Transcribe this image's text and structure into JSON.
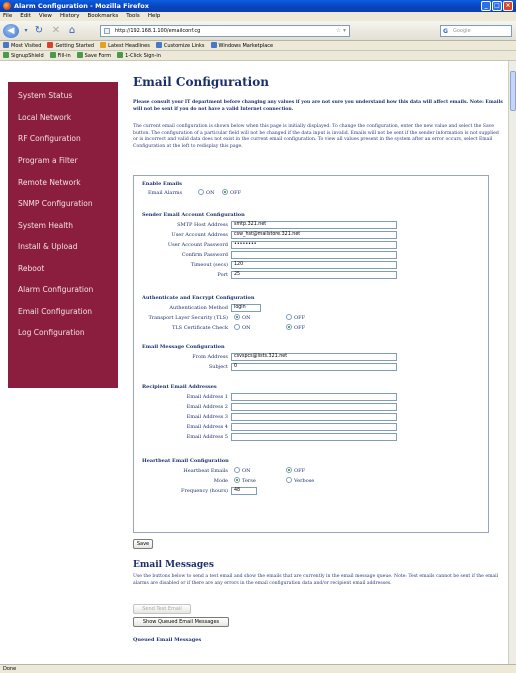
{
  "window": {
    "title": "Alarm Configuration - Mozilla Firefox"
  },
  "menu": [
    "File",
    "Edit",
    "View",
    "History",
    "Bookmarks",
    "Tools",
    "Help"
  ],
  "nav": {
    "url": "http://192.168.1.100/emailconf.cg",
    "search_placeholder": "Google"
  },
  "bookmarks": [
    {
      "label": "Most Visited",
      "color": "#4a78c8"
    },
    {
      "label": "Getting Started",
      "color": "#d8442a"
    },
    {
      "label": "Latest Headlines",
      "color": "#e8a020"
    },
    {
      "label": "Customize Links",
      "color": "#4a78c8"
    },
    {
      "label": "Windows Marketplace",
      "color": "#4a78c8"
    }
  ],
  "bookmarks2": [
    {
      "label": "SignupShield",
      "color": "#4a9a4a"
    },
    {
      "label": "Fill-in",
      "color": "#4a9a4a"
    },
    {
      "label": "Save Form",
      "color": "#4a9a4a"
    },
    {
      "label": "1-Click Sign-in",
      "color": "#4a9a4a"
    }
  ],
  "sidebar": {
    "items": [
      "System Status",
      "Local Network",
      "RF Configuration",
      "Program a Filter",
      "Remote Network",
      "SNMP Configuration",
      "System Health",
      "Install & Upload",
      "Reboot",
      "Alarm Configuration",
      "Email Configuration",
      "Log Configuration"
    ]
  },
  "page": {
    "title": "Email Configuration",
    "warning": "Please consult your IT department before changing any values if you are not sure you understand how this data will affect emails.  Note: Emails will not be sent if you do not have a valid Internet connection.",
    "intro": "The current email configuration is shown below when this page is initially displayed. To change the configuration, enter the new value and select the Save button. The configuration of a particular field will not be changed if the data input is invalid. Emails will not be sent if the sender information is not supplied or is incorrect and valid data does not exist in the current email configuration. To view all values present in the system after an error occurs, select Email Configuration at the left to redisplay this page."
  },
  "form": {
    "enable": {
      "heading": "Enable Emails",
      "label": "Email Alarms",
      "on": "ON",
      "off": "OFF",
      "selected": "off"
    },
    "sender": {
      "heading": "Sender Email Account Configuration",
      "smtp_label": "SMTP Host Address",
      "smtp_value": "smtp.321.net",
      "user_label": "User Account Address",
      "user_value": "csw_hst@mailstore.321.net",
      "pass_label": "User Account Password",
      "pass_value": "••••••••",
      "confirm_label": "Confirm Password",
      "confirm_value": "",
      "timeout_label": "Timeout (secs)",
      "timeout_value": "120",
      "port_label": "Port",
      "port_value": "25"
    },
    "auth": {
      "heading": "Authenticate and Encrypt Configuration",
      "method_label": "Authentication Method",
      "method_value": "login",
      "tls_label": "Transport Layer Security (TLS)",
      "tls_selected": "on",
      "cert_label": "TLS Certificate Check",
      "cert_selected": "off",
      "on": "ON",
      "off": "OFF"
    },
    "message": {
      "heading": "Email Message Configuration",
      "from_label": "From Address",
      "from_value": "csvspcs@lists.321.net",
      "subject_label": "Subject",
      "subject_value": "0"
    },
    "recipients": {
      "heading": "Recipient Email Addresses",
      "labels": [
        "Email Address 1",
        "Email Address 2",
        "Email Address 3",
        "Email Address 4",
        "Email Address 5"
      ]
    },
    "heartbeat": {
      "heading": "Heartbeat Email Configuration",
      "emails_label": "Heartbeat Emails",
      "emails_selected": "off",
      "mode_label": "Mode",
      "mode_terse": "Terse",
      "mode_verbose": "Verbose",
      "mode_selected": "terse",
      "freq_label": "Frequency (hours)",
      "freq_value": "48",
      "on": "ON",
      "off": "OFF"
    },
    "save_label": "Save"
  },
  "messages": {
    "title": "Email Messages",
    "info": "Use the buttons below to send a test email and show the emails that are currently in the email message queue. Note: Test emails cannot be sent if the email alarms are disabled or if there are any errors in the email configuration data and/or recipient email addresses.",
    "send_test": "Send Test Email",
    "show_queued": "Show Queued Email Messages",
    "queued_heading": "Queued Email Messages"
  },
  "status": {
    "text": "Done"
  }
}
